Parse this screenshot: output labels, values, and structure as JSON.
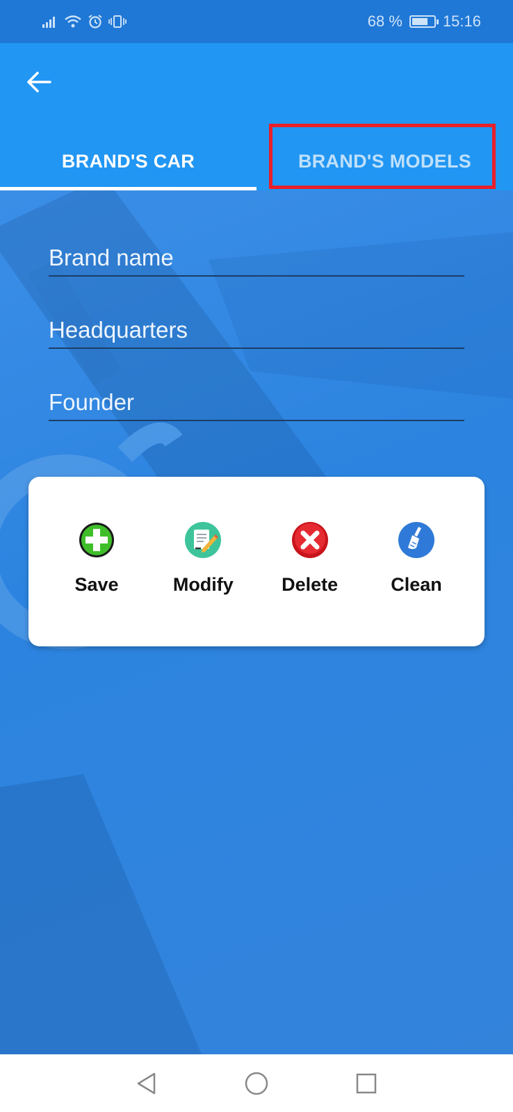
{
  "status_bar": {
    "battery_percent": "68 %",
    "time": "15:16",
    "battery_level": 0.68
  },
  "tabs": [
    {
      "label": "BRAND'S CAR",
      "active": true
    },
    {
      "label": "BRAND'S MODELS",
      "active": false
    }
  ],
  "form": {
    "brand_name": {
      "placeholder": "Brand name",
      "value": ""
    },
    "headquarters": {
      "placeholder": "Headquarters",
      "value": ""
    },
    "founder": {
      "placeholder": "Founder",
      "value": ""
    }
  },
  "actions": {
    "save": "Save",
    "modify": "Modify",
    "delete": "Delete",
    "clean": "Clean"
  },
  "colors": {
    "status_bar": "#1f78d6",
    "app_bar": "#2196f3",
    "content": "#2f86df",
    "highlight": "#e8202a"
  },
  "icons": {
    "back": "arrow-left-icon",
    "save": "plus-circle-icon",
    "modify": "edit-document-icon",
    "delete": "x-circle-icon",
    "clean": "broom-icon"
  }
}
